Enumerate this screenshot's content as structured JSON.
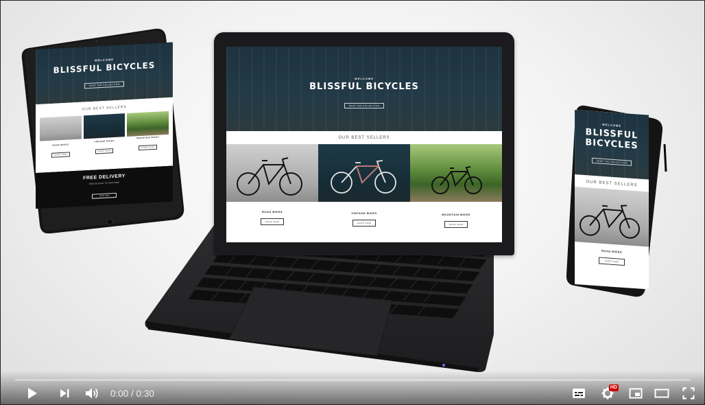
{
  "site": {
    "welcome": "WELCOME",
    "brand": "BLISSFUL BICYCLES",
    "brand_line1": "BLISSFUL",
    "brand_line2": "BICYCLES",
    "hero_button": "SHOP THE COLLECTION",
    "best_sellers": "OUR BEST SELLERS",
    "products": [
      {
        "label": "ROAD BIKES",
        "button": "SHOP NOW"
      },
      {
        "label": "VINTAGE BIKES",
        "button": "SHOP NOW"
      },
      {
        "label": "MOUNTAIN BIKES",
        "button": "SHOP NOW"
      }
    ],
    "delivery_title": "FREE DELIVERY",
    "delivery_text": "FREE DELIVERY TO YOUR DOOR",
    "delivery_button": "SHOP NOW"
  },
  "player": {
    "current_time": "0:00",
    "separator": " / ",
    "duration": "0:30",
    "progress": 0,
    "hd_badge": "HD",
    "icons": {
      "play": "play-icon",
      "next": "next-icon",
      "volume": "volume-icon",
      "subtitles": "subtitles-icon",
      "settings": "settings-icon",
      "miniplayer": "miniplayer-icon",
      "theater": "theater-icon",
      "fullscreen": "fullscreen-icon"
    }
  }
}
